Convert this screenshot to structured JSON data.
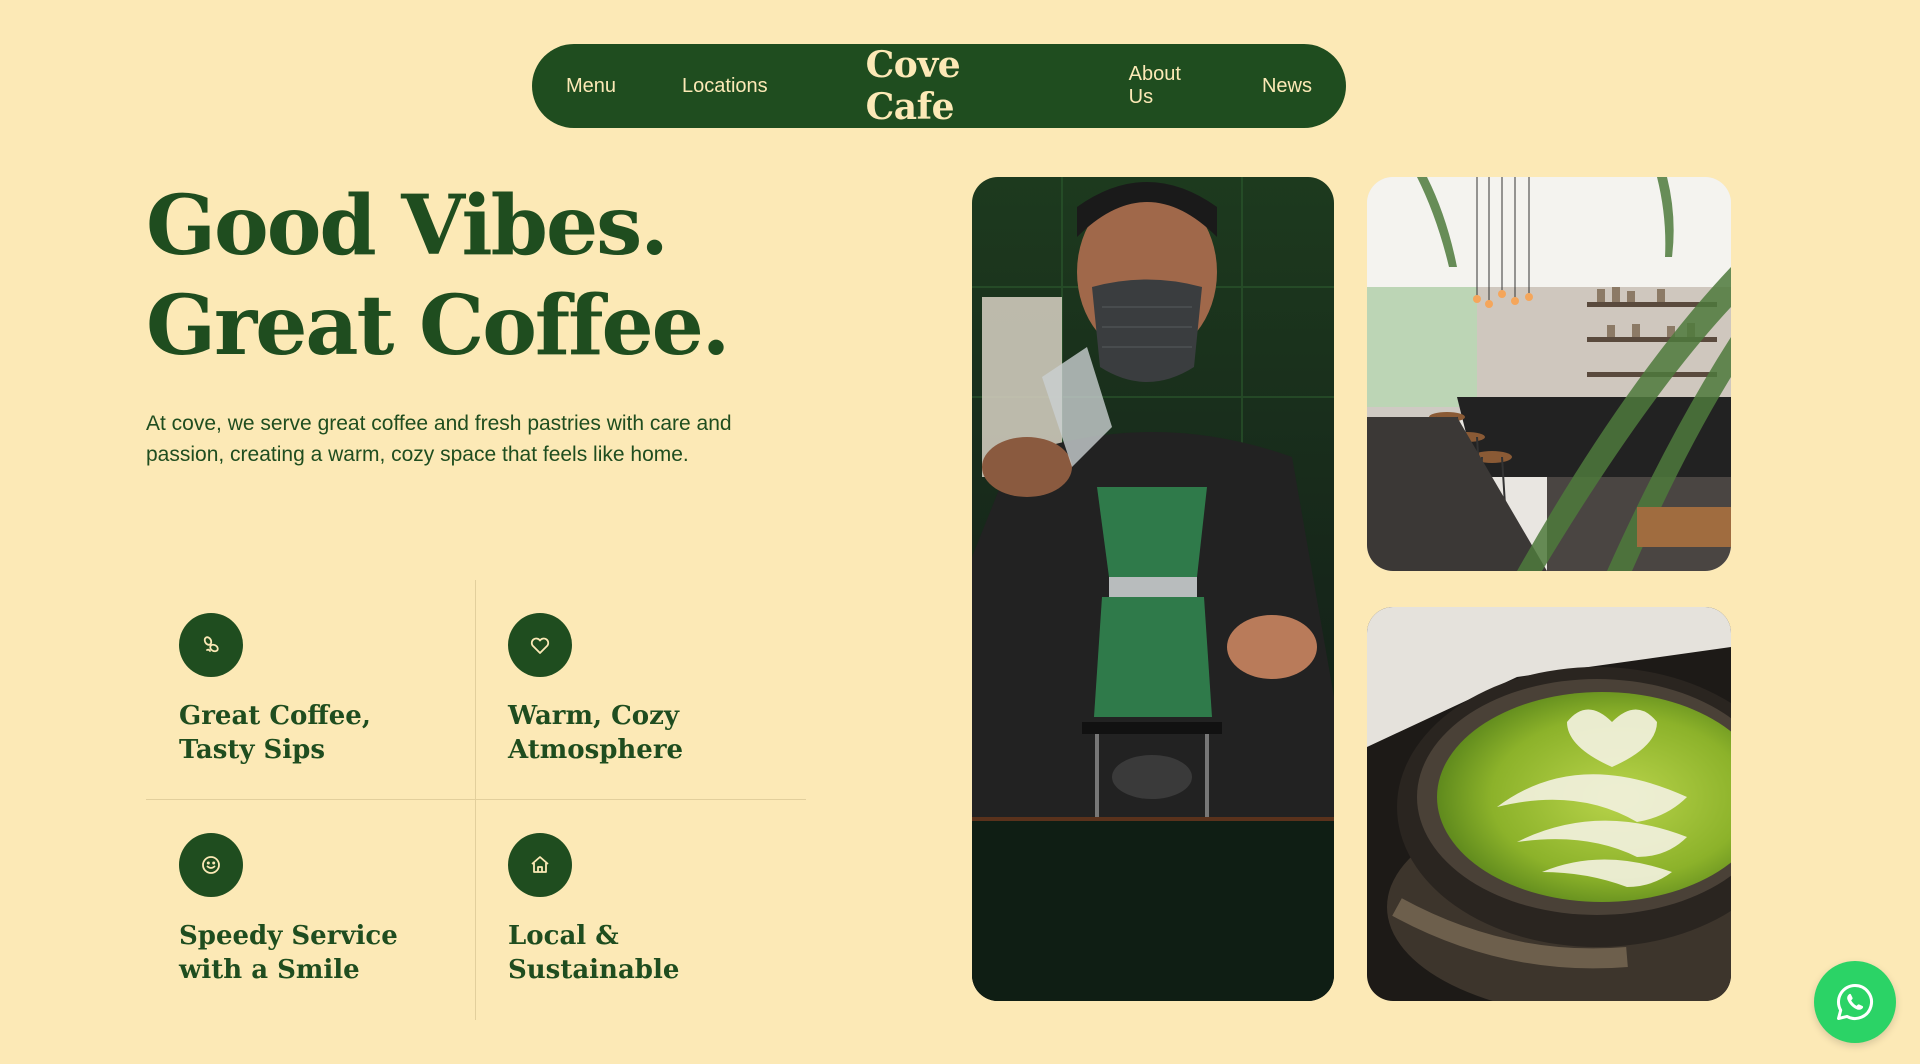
{
  "nav": {
    "links_left": [
      "Menu",
      "Locations"
    ],
    "brand": "Cove Cafe",
    "links_right": [
      "About Us",
      "News"
    ]
  },
  "hero": {
    "title_line1": "Good Vibes.",
    "title_line2": "Great Coffee.",
    "description": "At cove, we serve great coffee and fresh pastries with care and passion, creating a warm, cozy space that feels like home."
  },
  "features": [
    {
      "icon": "coffee-beans-icon",
      "line1": "Great Coffee,",
      "line2": "Tasty Sips"
    },
    {
      "icon": "heart-icon",
      "line1": "Warm, Cozy",
      "line2": "Atmosphere"
    },
    {
      "icon": "smile-icon",
      "line1": "Speedy Service",
      "line2": "with a Smile"
    },
    {
      "icon": "home-icon",
      "line1": "Local &",
      "line2": "Sustainable"
    }
  ],
  "images": {
    "barista": "barista-photo",
    "interior": "cafe-interior-photo",
    "latte": "matcha-latte-photo"
  },
  "whatsapp": {
    "icon": "whatsapp-icon"
  },
  "colors": {
    "background": "#fce9b6",
    "primary": "#1f4d1f",
    "accent": "#2bd366"
  }
}
